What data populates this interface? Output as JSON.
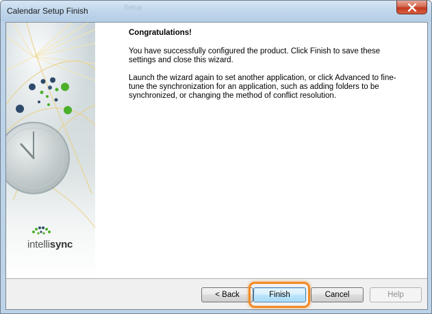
{
  "window": {
    "title": "Calendar Setup Finish",
    "title_ghost": "Setup"
  },
  "side_panel": {
    "brand_part1": "intelli",
    "brand_part2": "sync"
  },
  "main": {
    "heading": "Congratulations!",
    "paragraph1": "You have successfully configured the product. Click Finish to save these settings and close this wizard.",
    "paragraph2": "Launch the wizard again to set another application, or click Advanced to fine-tune the synchronization for an application, such as adding folders to be synchronized, or changing the method of conflict resolution."
  },
  "buttons": {
    "back": "< Back",
    "finish": "Finish",
    "cancel": "Cancel",
    "help": "Help"
  },
  "colors": {
    "highlight": "#f08a24",
    "close_button": "#c23a20",
    "brand_green": "#4caf2a",
    "brand_navy": "#2e4a6b"
  },
  "icons": {
    "close": "close-icon",
    "clock": "clock-icon",
    "logo": "intellisync-logo-icon"
  }
}
